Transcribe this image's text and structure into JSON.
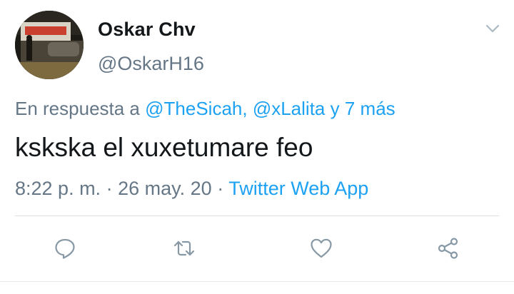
{
  "tweet": {
    "author_name": "Oskar Chv",
    "author_handle": "@OskarH16",
    "reply_prefix": "En respuesta a",
    "reply_users": [
      "@TheSicah",
      "@xLalita"
    ],
    "reply_more": "y 7 más",
    "text": "kskska el xuxetumare feo",
    "time": "8:22 p. m.",
    "date": "26 may. 20",
    "source": "Twitter Web App",
    "separator": "·"
  },
  "actions": {
    "reply_icon": "comment-icon",
    "retweet_icon": "retweet-icon",
    "like_icon": "heart-icon",
    "share_icon": "share-icon",
    "menu_icon": "chevron-down-icon"
  },
  "colors": {
    "accent": "#1da1f2",
    "secondary_text": "#657786",
    "primary_text": "#14171a"
  }
}
